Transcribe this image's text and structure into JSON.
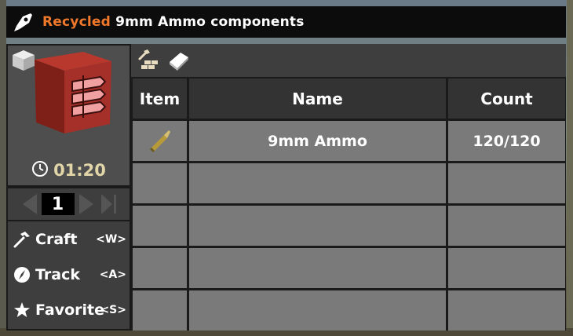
{
  "window": {
    "title_accent": "Recycled",
    "title_main": "9mm Ammo components",
    "title_icon": "rocket-icon"
  },
  "preview": {
    "item_icon": "ammo-crate-icon",
    "timer": "01:20",
    "timer_icon": "clock-icon"
  },
  "quantity": {
    "value": "1",
    "prev_icon": "arrow-left-icon",
    "next_icon": "arrow-right-icon",
    "last_icon": "skip-end-icon"
  },
  "actions": [
    {
      "label": "Craft",
      "key": "<W>",
      "icon": "hammer-icon"
    },
    {
      "label": "Track",
      "key": "<A>",
      "icon": "compass-icon"
    },
    {
      "label": "Favorite",
      "key": "<S>",
      "icon": "star-icon"
    }
  ],
  "toolbar": {
    "buttons": [
      "workbench-icon",
      "book-icon"
    ]
  },
  "table": {
    "headers": {
      "item": "Item",
      "name": "Name",
      "count": "Count"
    },
    "rows": [
      {
        "icon": "bullet-icon",
        "name": "9mm Ammo",
        "count": "120/120"
      },
      {
        "icon": "",
        "name": "",
        "count": ""
      },
      {
        "icon": "",
        "name": "",
        "count": ""
      },
      {
        "icon": "",
        "name": "",
        "count": ""
      },
      {
        "icon": "",
        "name": "",
        "count": ""
      }
    ]
  },
  "colors": {
    "accent": "#f0782a",
    "timer": "#e2d6a8",
    "panel_dark": "#1a1a1a",
    "panel_mid": "#3e3e3e",
    "cell": "#7a7a7a"
  }
}
